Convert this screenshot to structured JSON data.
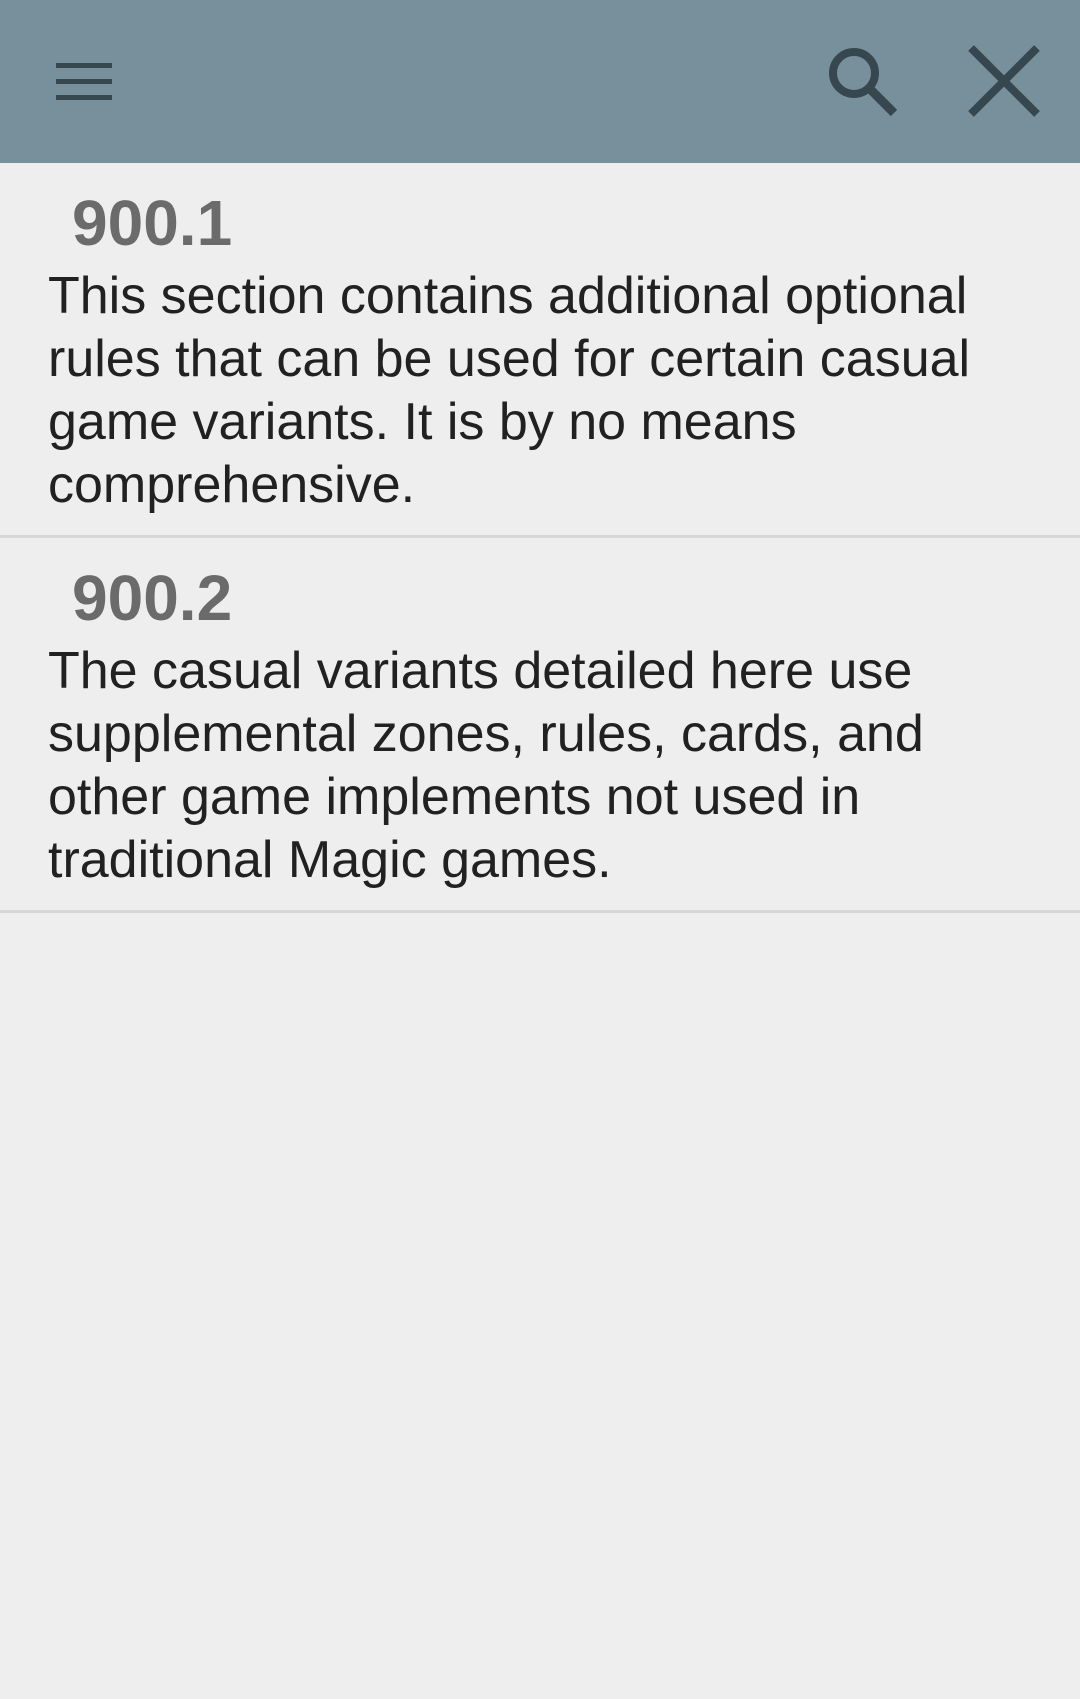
{
  "toolbar": {
    "menu_icon": "hamburger-menu-icon",
    "search_icon": "search-icon",
    "close_icon": "close-icon",
    "background_color": "#78909c",
    "icon_color": "#37474f"
  },
  "rules": [
    {
      "number": "900.1",
      "text": "This section contains additional optional rules that can be used for certain casual game variants. It is by no means comprehensive."
    },
    {
      "number": "900.2",
      "text": "The casual variants detailed here use supplemental zones, rules, cards, and other game implements not used in traditional Magic games."
    }
  ]
}
